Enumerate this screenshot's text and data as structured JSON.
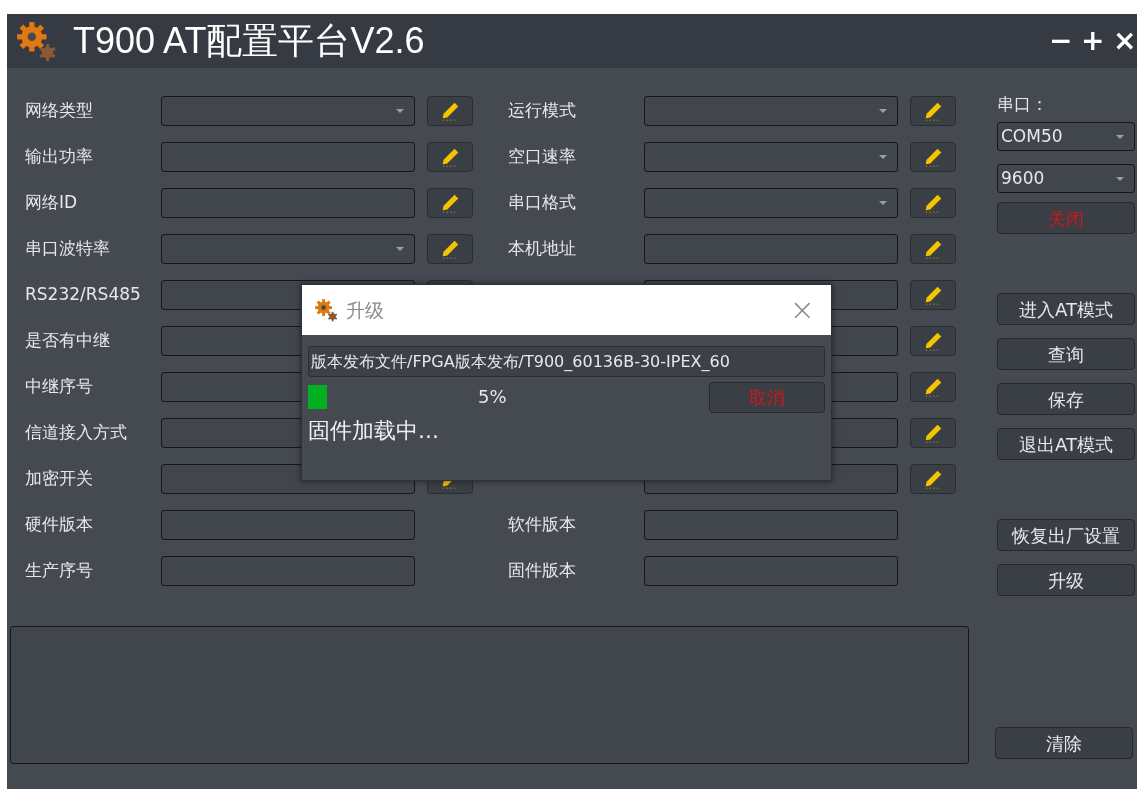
{
  "window": {
    "title": "T900 AT配置平台V2.6",
    "controls": [
      "−",
      "+",
      "×"
    ]
  },
  "form": {
    "left": [
      {
        "label": "网络类型",
        "kind": "combo",
        "editable": true
      },
      {
        "label": "输出功率",
        "kind": "text",
        "editable": true
      },
      {
        "label": "网络ID",
        "kind": "text",
        "editable": true
      },
      {
        "label": "串口波特率",
        "kind": "combo",
        "editable": true
      },
      {
        "label": "RS232/RS485",
        "kind": "text",
        "editable": true
      },
      {
        "label": "是否有中继",
        "kind": "text"
      },
      {
        "label": "中继序号",
        "kind": "text"
      },
      {
        "label": "信道接入方式",
        "kind": "text"
      },
      {
        "label": "加密开关",
        "kind": "text",
        "editable": true
      },
      {
        "label": "硬件版本",
        "kind": "text",
        "editable": false
      },
      {
        "label": "生产序号",
        "kind": "text",
        "editable": false
      }
    ],
    "right": [
      {
        "label": "运行模式",
        "kind": "combo",
        "editable": true
      },
      {
        "label": "空口速率",
        "kind": "combo",
        "editable": true
      },
      {
        "label": "串口格式",
        "kind": "combo",
        "editable": true
      },
      {
        "label": "本机地址",
        "kind": "text",
        "editable": true
      },
      {
        "kind": "text",
        "editable": true
      },
      {
        "kind": "text",
        "editable": true
      },
      {
        "kind": "text",
        "editable": true
      },
      {
        "kind": "text",
        "editable": true
      },
      {
        "kind": "text",
        "editable": true
      },
      {
        "label": "软件版本",
        "kind": "text",
        "editable": false
      },
      {
        "label": "固件版本",
        "kind": "text",
        "editable": false
      }
    ]
  },
  "serial": {
    "label": "串口：",
    "port": "COM50",
    "baud": "9600",
    "toggle": {
      "label": "关闭",
      "kind": "danger"
    }
  },
  "at_actions": [
    "进入AT模式",
    "查询",
    "保存",
    "退出AT模式"
  ],
  "device_actions": [
    "恢复出厂设置",
    "升级"
  ],
  "clear_button": "清除",
  "dialog": {
    "title": "升级",
    "close": "×",
    "path": "版本发布文件/FPGA版本发布/T900_60136B-30-IPEX_60",
    "progress": {
      "level": 0.05,
      "reading": "5%"
    },
    "cancel": {
      "label": "取消",
      "kind": "danger"
    },
    "status": "固件加载中..."
  }
}
